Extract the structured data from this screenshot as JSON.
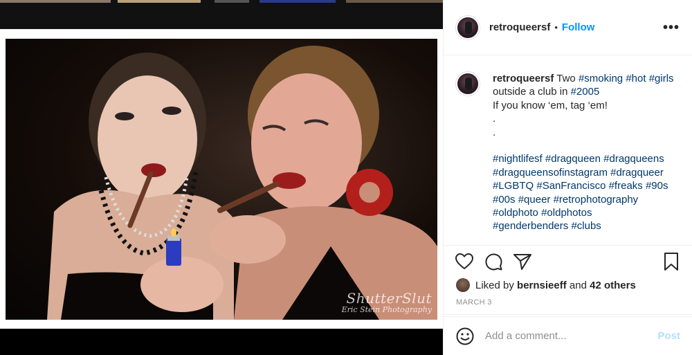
{
  "post": {
    "username": "retroqueersf",
    "separator": "•",
    "follow_label": "Follow",
    "more_label": "•••",
    "photo_alt": "Two women smoking cigarillos, lighting with a lighter",
    "watermark": {
      "line1": "ShutterSlut",
      "line2": "Eric Stein Photography"
    }
  },
  "caption": {
    "username": "retroqueersf",
    "line1_text_a": "Two ",
    "tag_smoking": "#smoking",
    "tag_hot": "#hot",
    "tag_girls": "#girls",
    "line2_text": "outside a club in ",
    "tag_2005": "#2005",
    "line3": "If you know ‘em, tag ‘em!",
    "dot1": ".",
    "dot2": ".",
    "hashtags": [
      "#nightlifesf",
      "#dragqueen",
      "#dragqueens",
      "#dragqueensofinstagram",
      "#dragqueer",
      "#LGBTQ",
      "#SanFrancisco",
      "#freaks",
      "#90s",
      "#00s",
      "#queer",
      "#retrophotography",
      "#oldphoto",
      "#oldphotos",
      "#genderbenders",
      "#clubs"
    ]
  },
  "actions": {
    "like_icon": "heart-icon",
    "comment_icon": "comment-bubble-icon",
    "share_icon": "paper-plane-icon",
    "save_icon": "bookmark-icon"
  },
  "likes": {
    "prefix": "Liked by ",
    "user": "bernsieeff",
    "middle": " and ",
    "others": "42 others"
  },
  "date": "MARCH 3",
  "comment": {
    "placeholder": "Add a comment...",
    "post_label": "Post",
    "emoji_icon": "smiley-icon"
  },
  "colors": {
    "accent": "#0095f6",
    "hashtag": "#00376b",
    "post_disabled": "#b2dffc",
    "muted": "#8e8e8e"
  }
}
